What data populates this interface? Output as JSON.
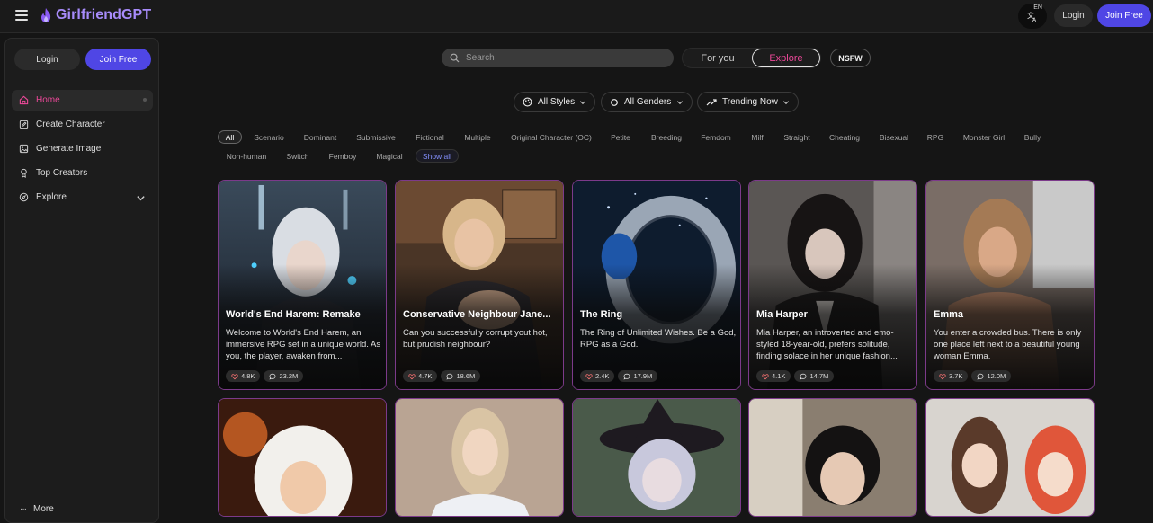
{
  "brand": {
    "name": "GirlfriendGPT"
  },
  "topbar": {
    "lang_code": "EN",
    "login_label": "Login",
    "join_label": "Join Free"
  },
  "sidebar": {
    "login_label": "Login",
    "join_label": "Join Free",
    "items": [
      {
        "label": "Home",
        "icon": "home-icon",
        "active": true
      },
      {
        "label": "Create Character",
        "icon": "edit-icon"
      },
      {
        "label": "Generate Image",
        "icon": "image-icon"
      },
      {
        "label": "Top Creators",
        "icon": "trophy-icon"
      },
      {
        "label": "Explore",
        "icon": "compass-icon"
      }
    ],
    "more_label": "More"
  },
  "search": {
    "placeholder": "Search"
  },
  "feed_tabs": {
    "for_you": "For you",
    "explore": "Explore",
    "active": "Explore"
  },
  "nsfw_label": "NSFW",
  "filters": {
    "styles": "All Styles",
    "genders": "All Genders",
    "sort": "Trending Now"
  },
  "tags": [
    "All",
    "Scenario",
    "Dominant",
    "Submissive",
    "Fictional",
    "Multiple",
    "Original Character (OC)",
    "Petite",
    "Breeding",
    "Femdom",
    "Milf",
    "Straight",
    "Cheating",
    "Bisexual",
    "RPG",
    "Monster Girl",
    "Bully",
    "Non-human",
    "Switch",
    "Femboy",
    "Magical"
  ],
  "show_all_label": "Show all",
  "accent": "#ec4899",
  "brand_color": "#a78bfa",
  "primary_button": "#4f46e5",
  "cards": [
    {
      "title": "World's End Harem: Remake",
      "desc": "Welcome to World's End Harem, an immersive RPG set in a unique world. As you, the player, awaken from...",
      "likes": "4.8K",
      "chats": "23.2M"
    },
    {
      "title": "Conservative Neighbour Jane...",
      "desc": "Can you successfully corrupt yout hot, but prudish neighbour?",
      "likes": "4.7K",
      "chats": "18.6M"
    },
    {
      "title": "The Ring",
      "desc": "The Ring of Unlimited Wishes. Be a God, RPG as a God.",
      "likes": "2.4K",
      "chats": "17.9M"
    },
    {
      "title": "Mia Harper",
      "desc": "Mia Harper, an introverted and emo-styled 18-year-old, prefers solitude, finding solace in her unique fashion...",
      "likes": "4.1K",
      "chats": "14.7M"
    },
    {
      "title": "Emma",
      "desc": "You enter a crowded bus. There is only one place left next to a beautiful young woman Emma.",
      "likes": "3.7K",
      "chats": "12.0M"
    }
  ]
}
